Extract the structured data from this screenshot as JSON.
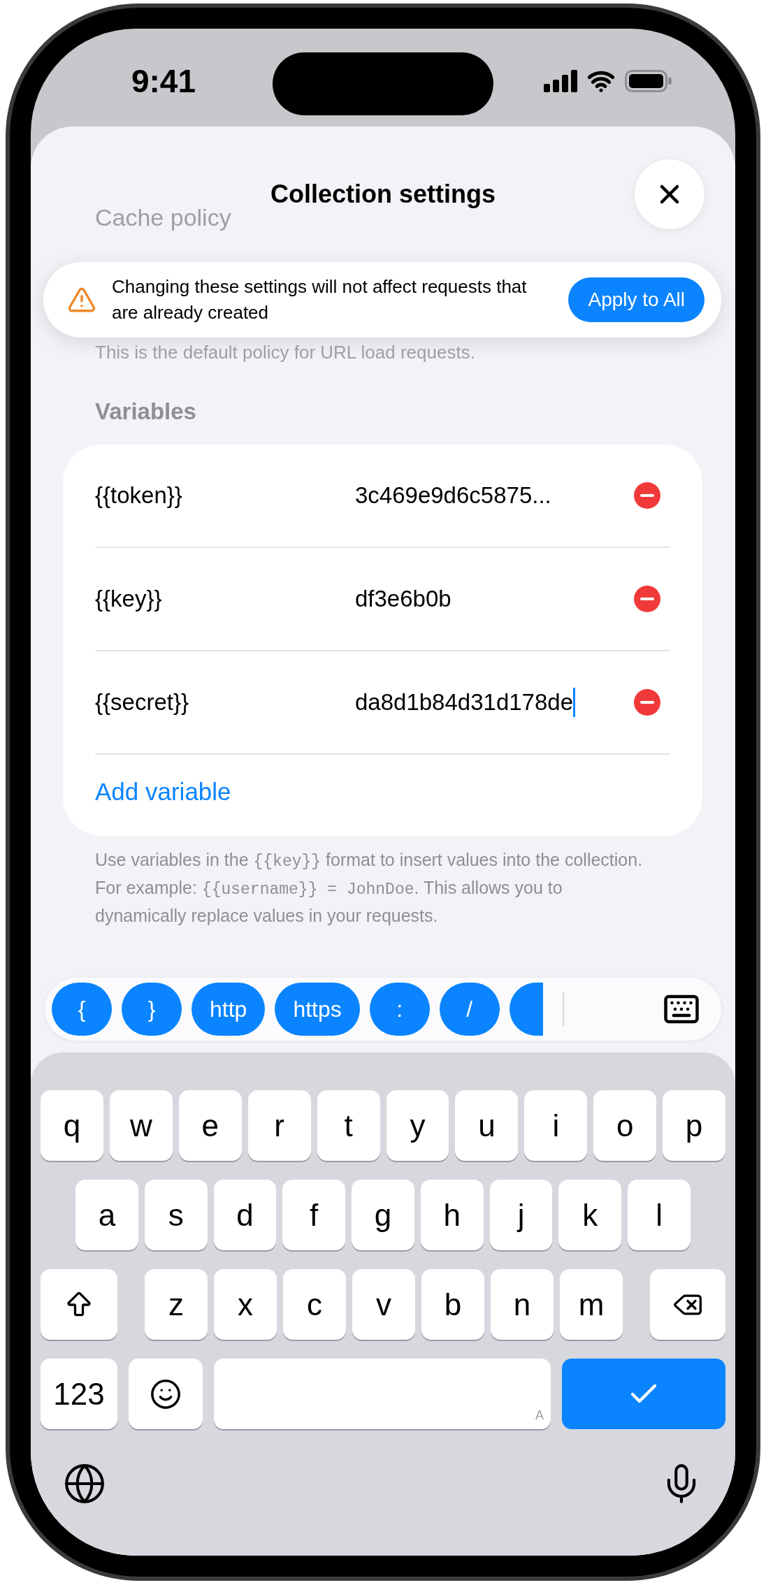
{
  "status_bar": {
    "time": "9:41"
  },
  "sheet": {
    "title": "Collection settings",
    "behind_label": "Cache policy"
  },
  "banner": {
    "message": "Changing these settings will not affect requests that are already created",
    "button": "Apply to All"
  },
  "policy_note": "This is the default policy for URL load requests.",
  "variables": {
    "header": "Variables",
    "rows": [
      {
        "name": "{{token}}",
        "value": "3c469e9d6c5875...",
        "editing": false
      },
      {
        "name": "{{key}}",
        "value": "df3e6b0b",
        "editing": false
      },
      {
        "name": "{{secret}}",
        "value": "da8d1b84d31d178de",
        "editing": true
      }
    ],
    "add_label": "Add variable",
    "footer": [
      {
        "kind": "plain",
        "text": "Use variables in the "
      },
      {
        "kind": "code",
        "text": "{{key}}"
      },
      {
        "kind": "plain",
        "text": " format to insert values into the collection. For example: "
      },
      {
        "kind": "code",
        "text": "{{username}} = JohnDoe"
      },
      {
        "kind": "plain",
        "text": ". This allows you to dynamically replace values in your requests."
      }
    ]
  },
  "accessory": {
    "chips": [
      "{",
      "}",
      "http",
      "https",
      ":",
      "/"
    ]
  },
  "keyboard": {
    "rows": [
      [
        "q",
        "w",
        "e",
        "r",
        "t",
        "y",
        "u",
        "i",
        "o",
        "p"
      ],
      [
        "a",
        "s",
        "d",
        "f",
        "g",
        "h",
        "j",
        "k",
        "l"
      ],
      [
        "z",
        "x",
        "c",
        "v",
        "b",
        "n",
        "m"
      ]
    ],
    "numbers_key": "123",
    "space_hint": "A"
  }
}
